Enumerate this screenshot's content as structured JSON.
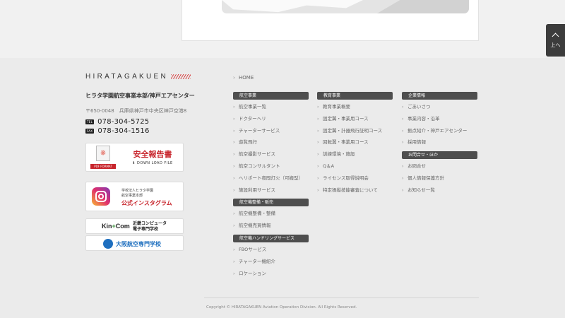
{
  "side_tab": {
    "label": "上へ"
  },
  "logo": {
    "text": "HIRATAGAKUEN"
  },
  "company": {
    "name": "ヒラタ学園航空事業本部/神戸エアセンター",
    "address": "〒650-0048　兵庫県神戸市中央区神戸空港8",
    "tel_tag": "TEL",
    "tel": "078-304-5725",
    "fax_tag": "FAX",
    "fax": "078-304-1516"
  },
  "banners": {
    "safety": {
      "pdf_label": "PDF FORMAT",
      "title": "安全報告書",
      "download": "⬇ DOWN LOAD FILE"
    },
    "instagram": {
      "line1": "学校法人ヒラタ学園",
      "line2": "航空事業本部",
      "main": "公式インスタグラム"
    },
    "kinkom": {
      "logo_pre": "Kin",
      "logo_plus": "+",
      "logo_post": "Com",
      "line1": "近畿コンピュータ",
      "line2": "電子専門学校"
    },
    "osaka": {
      "title": "大阪航空専門学校"
    }
  },
  "nav": {
    "home": "HOME",
    "aviation": {
      "header": "航空事業",
      "items": [
        "航空事業一覧",
        "ドクターヘリ",
        "チャーターサービス",
        "遊覧飛行",
        "航空撮影サービス",
        "航空コンサルタント",
        "ヘリポート夜間灯火（可搬型）",
        "施設利用サービス"
      ]
    },
    "maintenance": {
      "header": "航空機整備・販売",
      "items": [
        "航空機整備・整備",
        "航空機売買情報"
      ]
    },
    "handling": {
      "header": "航空機ハンドリングサービス",
      "items": [
        "FBOサービス",
        "チャーター機紹介",
        "ロケーション"
      ]
    },
    "education": {
      "header": "教育事業",
      "items": [
        "教育事業概要",
        "固定翼・事業用コース",
        "固定翼・計器飛行証明コース",
        "回転翼・事業用コース",
        "訓練環境・施設",
        "Q＆A",
        "ライセンス取得説明会",
        "特定操縦技能審査について"
      ]
    },
    "corporate": {
      "header": "企業情報",
      "items": [
        "ごあいさつ",
        "事業内容・沿革",
        "拠点紹介・神戸エアセンター",
        "採用情報"
      ]
    },
    "contact": {
      "header": "お問合せ・ほか",
      "items": [
        "お問合せ",
        "個人情報保護方針",
        "お知らせ一覧"
      ]
    }
  },
  "footer": {
    "copyright": "Copyright © HIRATAGAKUEN Aviation Operation Division. All Rights Reserved."
  }
}
